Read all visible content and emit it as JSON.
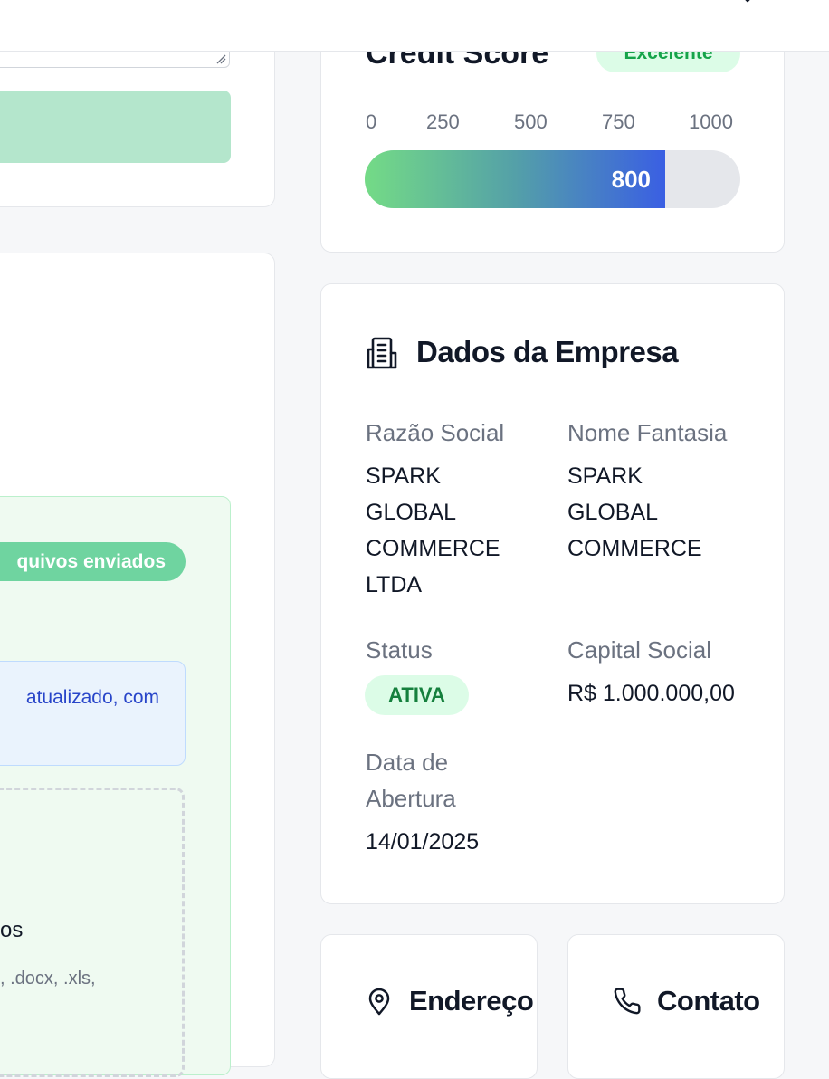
{
  "credit": {
    "title": "Credit Score",
    "badge": "Excelente",
    "ticks": [
      "0",
      "250",
      "500",
      "750",
      "1000"
    ],
    "value": 800,
    "value_label": "800",
    "max": 1000
  },
  "upload": {
    "files_badge": "quivos enviados",
    "info_text": "atualizado, com",
    "dropzone_title": "os",
    "dropzone_formats": ", .docx, .xls,"
  },
  "empresa": {
    "title": "Dados da Empresa",
    "razao_label": "Razão Social",
    "razao_value": [
      "SPARK",
      "GLOBAL",
      "COMMERCE",
      "LTDA"
    ],
    "fantasia_label": "Nome Fantasia",
    "fantasia_value": [
      "SPARK",
      "GLOBAL",
      "COMMERCE"
    ],
    "status_label": "Status",
    "status_value": "ATIVA",
    "capital_label": "Capital Social",
    "capital_value": "R$ 1.000.000,00",
    "abertura_label": [
      "Data de",
      "Abertura"
    ],
    "abertura_value": "14/01/2025"
  },
  "endereco": {
    "title": "Endereço",
    "icon": "map-pin-icon"
  },
  "contato": {
    "title": "Contato",
    "icon": "phone-icon"
  },
  "colors": {
    "accent_green": "#16a34a",
    "gauge_start": "#74db86",
    "gauge_end": "#3a5fe3"
  }
}
